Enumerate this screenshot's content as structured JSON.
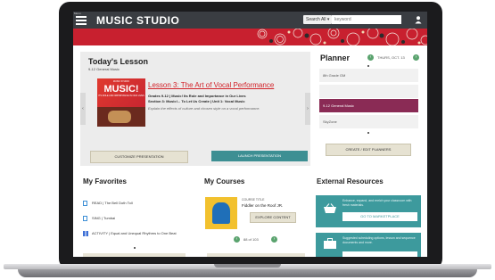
{
  "header": {
    "menu_caption": "Menu",
    "logo": "MUSIC STUDIO",
    "search_scope": "Search All",
    "search_placeholder": "keyword"
  },
  "todays_lesson": {
    "title": "Today's Lesson",
    "subtitle": "9-12 General Music",
    "book": {
      "top_text": "MUSIC STUDIO",
      "title": "MUSIC!",
      "sub_text": "ITS ROLE AND IMPORTANCE IN OUR LIVES"
    },
    "lesson_title": "Lesson 3: The Art of Vocal Performance",
    "grades_line": "Grades 9-12 | Music! Its Role and Importance in Our Lives",
    "section_line": "Section 3: Music!... To Let Us Create | Unit 1: Vocal Music",
    "description": "Explain the effects of culture and chosen style on a vocal performance.",
    "customize_label": "CUSTOMIZE PRESENTATION",
    "launch_label": "LAUNCH PRESENTATION"
  },
  "planner": {
    "title": "Planner",
    "date": "THURS, OCT. 13",
    "items": [
      {
        "label": "8th Grade GM"
      },
      {
        "label": "9-12 General Music"
      },
      {
        "label": "SkyZone"
      }
    ],
    "create_label": "CREATE / EDIT PLANNERS"
  },
  "favorites": {
    "title": "My Favorites",
    "items": [
      {
        "label": "READ | The Bell Doth Toll"
      },
      {
        "label": "SING | Tumbai"
      },
      {
        "label": "ACTIVITY | Equal and Unequal Rhythms to One Beat"
      }
    ]
  },
  "courses": {
    "title": "My Courses",
    "course_label": "COURSE TITLE",
    "course_name": "Fiddler on the Roof JR.",
    "explore_label": "EXPLORE CONTENT",
    "pagination": "88 of 103"
  },
  "external": {
    "title": "External Resources",
    "card1_text": "Enhance, expand, and enrich your classroom with fresh materials.",
    "card1_button": "GO TO MARKETPLACE",
    "card2_text": "Suggested scheduling options, lesson and sequence documents and more."
  },
  "colors": {
    "header_bg": "#3a3d42",
    "banner_red": "#c8202f",
    "accent_teal": "#3d8f93",
    "planner_active": "#8a2b55",
    "lesson_link": "#d2232a",
    "arrow_green": "#5aa36e"
  }
}
